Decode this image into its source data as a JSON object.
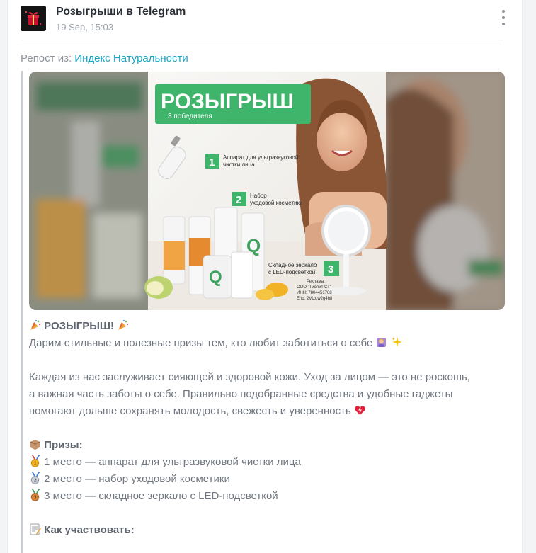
{
  "post": {
    "channel_name": "Розыгрыши в Telegram",
    "timestamp": "19 Sep, 15:03",
    "repost_prefix": "Репост из:",
    "repost_source": "Индекс Натуральности"
  },
  "banner": {
    "headline": "РОЗЫГРЫШ",
    "subhead": "3 победителя",
    "items": [
      {
        "num": "1",
        "text1": "Аппарат для ультразвуковой",
        "text2": "чистки лица"
      },
      {
        "num": "2",
        "text1": "Набор",
        "text2": "уходовой косметики"
      },
      {
        "num": "3",
        "text1": "Складное зеркало",
        "text2": "с LED-подсветкой"
      }
    ],
    "ad_line1": "Реклама:",
    "ad_line2": "ООО \"Тиолит СТ\"",
    "ad_line3": "ИНН: 7804451708",
    "ad_line4": "Erid: 2Vtzqw2g4h8"
  },
  "text": {
    "title": "РОЗЫГРЫШ!",
    "subtitle": "Дарим стильные и полезные призы тем, кто любит заботиться о себе",
    "para_line1": "Каждая из нас заслуживает сияющей и здоровой кожи. Уход за лицом — это не роскошь,",
    "para_line2": "а важная часть заботы о себе. Правильно подобранные средства и удобные гаджеты",
    "para_line3": "помогают дольше сохранять молодость, свежесть и уверенность",
    "prizes_title": "Призы:",
    "prize1": "1 место — аппарат для ультразвуковой чистки лица",
    "prize2": "2 место — набор уходовой косметики",
    "prize3": "3 место — складное зеркало с LED-подсветкой",
    "how_title": "Как участвовать:"
  },
  "icons": {
    "avatar": "gift-logo-icon",
    "more": "more-vertical-icon",
    "confetti": "party-popper-icon",
    "woman": "woman-icon",
    "sparkles": "sparkles-icon",
    "heart": "heart-icon",
    "box": "box-icon",
    "medal1": "gold-medal-icon",
    "medal2": "silver-medal-icon",
    "medal3": "bronze-medal-icon",
    "memo": "memo-icon"
  },
  "colors": {
    "banner_green": "#3fb56b",
    "link": "#19a5c6"
  }
}
